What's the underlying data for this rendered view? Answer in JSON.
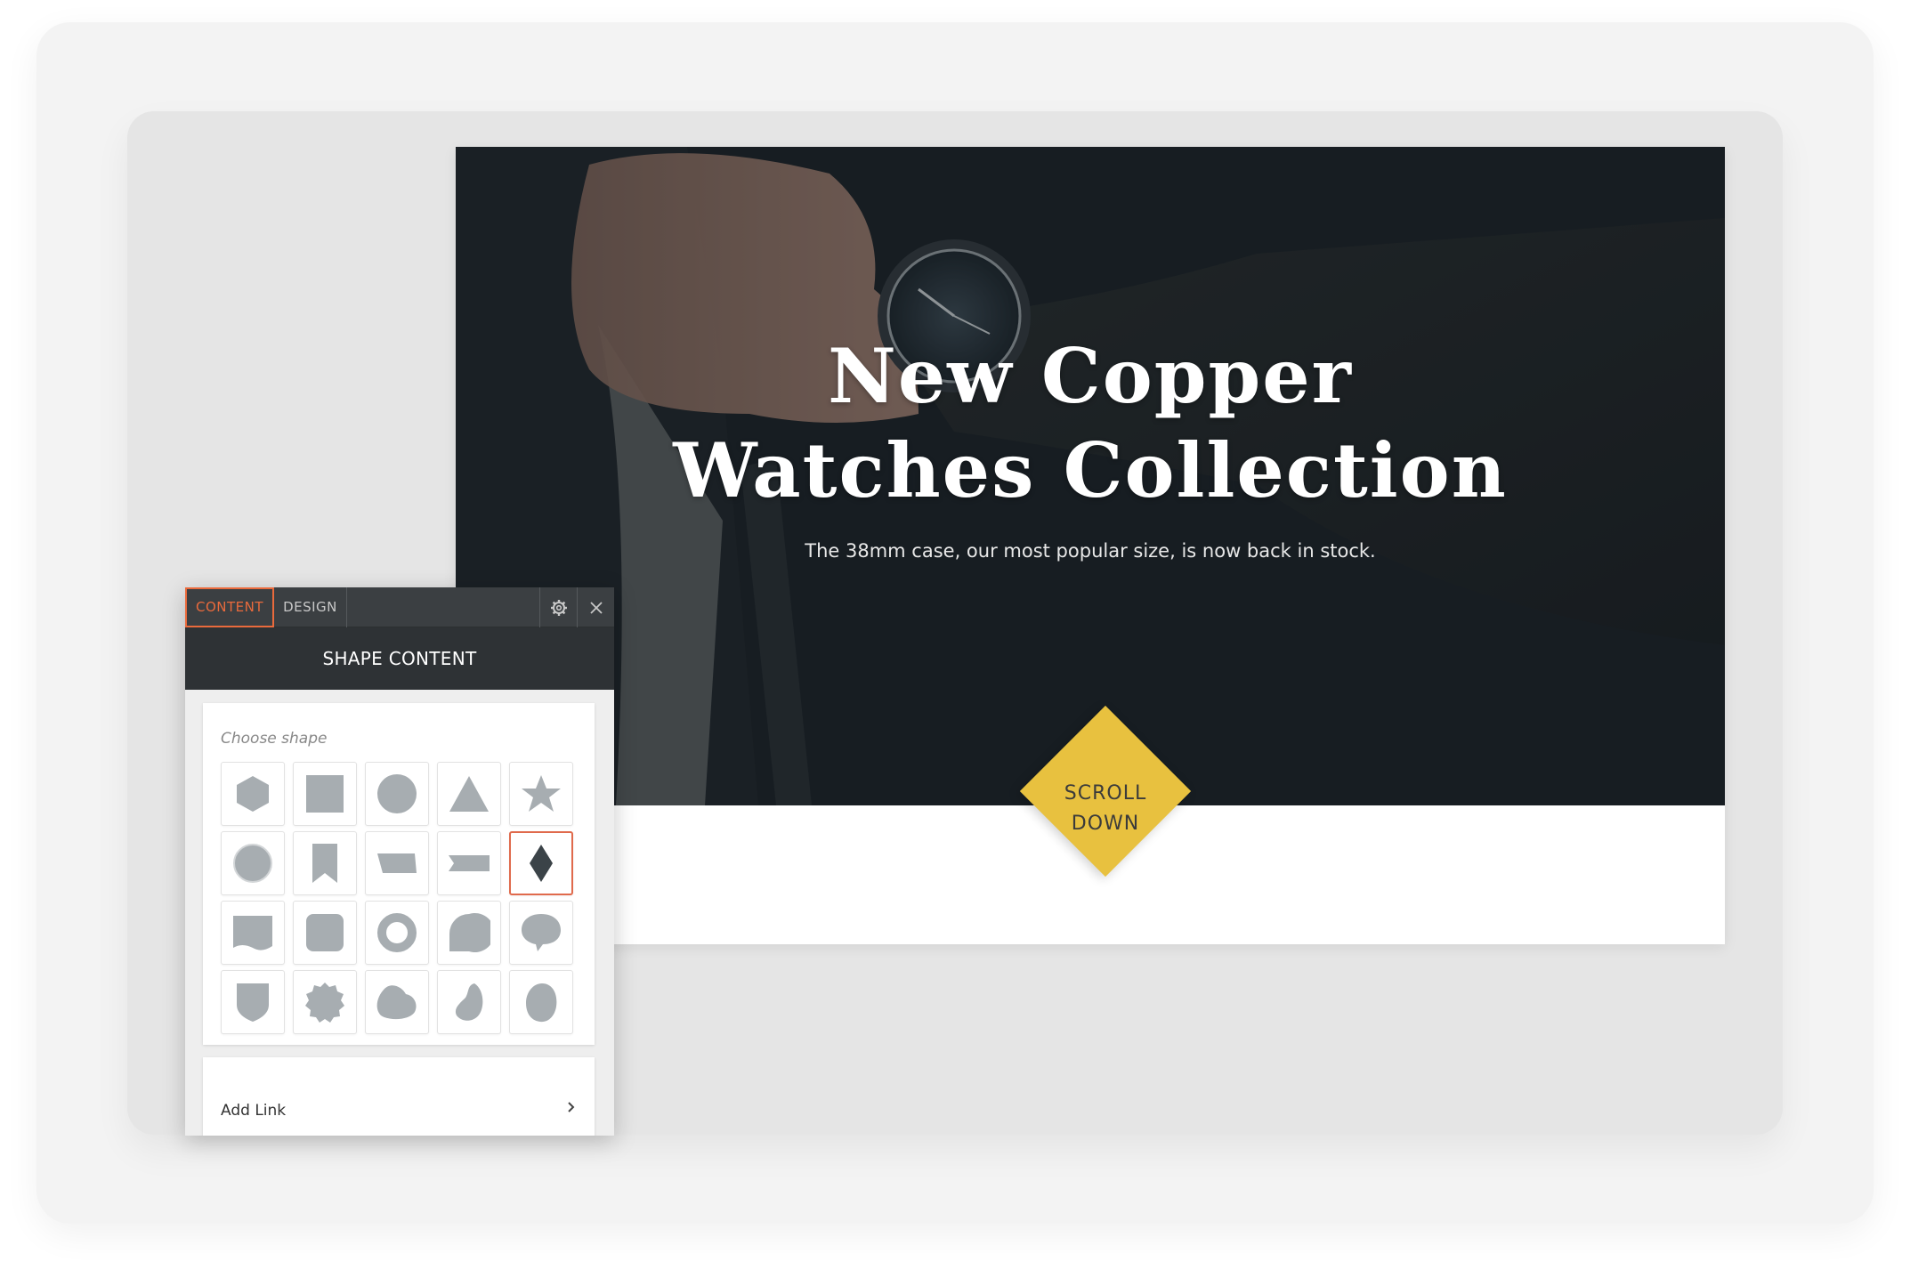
{
  "hero": {
    "title_line1": "New Copper",
    "title_line2": "Watches Collection",
    "subtitle": "The 38mm case, our most popular size, is now back in stock.",
    "cta_line1": "SCROLL",
    "cta_line2": "DOWN",
    "cta_color": "#e8c13f"
  },
  "panel": {
    "tabs": [
      {
        "label": "CONTENT",
        "active": true
      },
      {
        "label": "DESIGN",
        "active": false
      }
    ],
    "header": "SHAPE CONTENT",
    "choose_shape_label": "Choose shape",
    "shapes": [
      "hexagon-icon",
      "square-icon",
      "circle-icon",
      "triangle-icon",
      "star-icon",
      "circle-outline-icon",
      "bookmark-icon",
      "parallelogram-icon",
      "ribbon-icon",
      "diamond-icon",
      "wave-rect-icon",
      "rounded-square-icon",
      "ring-icon",
      "speech-bubble-icon",
      "speech-bubble-round-icon",
      "shield-icon",
      "badge-icon",
      "blob-icon",
      "leaf-blob-icon",
      "egg-blob-icon"
    ],
    "selected_shape": "diamond-icon",
    "add_link_label": "Add Link",
    "accent_color": "#ea6a3c"
  }
}
